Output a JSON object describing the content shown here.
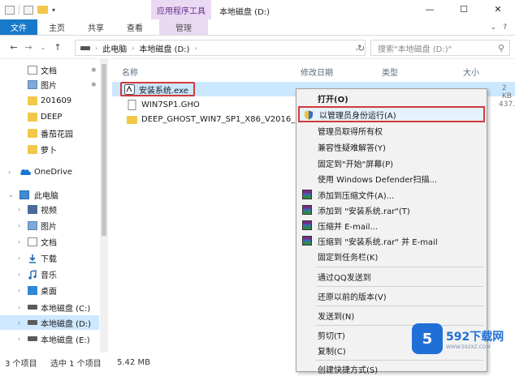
{
  "titlebar": {
    "context_tab_title": "应用程序工具",
    "window_title": "本地磁盘 (D:)",
    "controls": [
      "—",
      "☐",
      "✕"
    ]
  },
  "ribbon": {
    "tabs": [
      "文件",
      "主页",
      "共享",
      "查看",
      "管理"
    ],
    "right_icons": [
      "⌄",
      "?"
    ]
  },
  "address": {
    "back": "←",
    "forward": "→",
    "recent": "⌄",
    "up": "↑",
    "path": [
      "此电脑",
      "本地磁盘 (D:)"
    ],
    "search_placeholder": "搜索\"本地磁盘 (D:)\""
  },
  "sidebar": {
    "items": [
      {
        "label": "文档",
        "icon": "document-icon",
        "pinned": true
      },
      {
        "label": "图片",
        "icon": "pictures-icon",
        "pinned": true
      },
      {
        "label": "201609",
        "icon": "folder-icon"
      },
      {
        "label": "DEEP",
        "icon": "folder-icon"
      },
      {
        "label": "番茄花园",
        "icon": "folder-icon"
      },
      {
        "label": "萝卜",
        "icon": "folder-icon"
      },
      {
        "label": "OneDrive",
        "icon": "onedrive-icon"
      },
      {
        "label": "此电脑",
        "icon": "computer-icon"
      },
      {
        "label": "视频",
        "icon": "video-icon"
      },
      {
        "label": "图片",
        "icon": "pictures-icon"
      },
      {
        "label": "文档",
        "icon": "document-icon"
      },
      {
        "label": "下载",
        "icon": "download-icon"
      },
      {
        "label": "音乐",
        "icon": "music-icon"
      },
      {
        "label": "桌面",
        "icon": "desktop-icon"
      },
      {
        "label": "本地磁盘 (C:)",
        "icon": "drive-icon"
      },
      {
        "label": "本地磁盘 (D:)",
        "icon": "drive-icon",
        "selected": true
      },
      {
        "label": "本地磁盘 (E:)",
        "icon": "drive-icon"
      }
    ]
  },
  "columns": {
    "name": "名称",
    "modified": "修改日期",
    "type": "类型",
    "size": "大小"
  },
  "files": [
    {
      "name": "安装系统.exe",
      "icon": "exe-icon",
      "selected": true,
      "size_partial": "2 KB"
    },
    {
      "name": "WIN7SP1.GHO",
      "icon": "gho-file-icon",
      "size_partial": "437..."
    },
    {
      "name": "DEEP_GHOST_WIN7_SP1_X86_V2016_...",
      "icon": "folder-icon"
    }
  ],
  "status": {
    "count": "3 个项目",
    "selected": "选中 1 个项目",
    "size": "5.42 MB"
  },
  "context_menu": {
    "items": [
      {
        "label": "打开(O)",
        "bold": true
      },
      {
        "label": "以管理员身份运行(A)",
        "icon": "shield-icon",
        "highlighted": true
      },
      {
        "label": "管理员取得所有权"
      },
      {
        "label": "兼容性疑难解答(Y)"
      },
      {
        "label": "固定到\"开始\"屏幕(P)"
      },
      {
        "label": "使用 Windows Defender扫描..."
      },
      {
        "label": "添加到压缩文件(A)...",
        "icon": "rar-icon"
      },
      {
        "label": "添加到 \"安装系统.rar\"(T)",
        "icon": "rar-icon"
      },
      {
        "label": "压缩并 E-mail...",
        "icon": "rar-icon"
      },
      {
        "label": "压缩到 \"安装系统.rar\" 并 E-mail",
        "icon": "rar-icon"
      },
      {
        "label": "固定到任务栏(K)"
      },
      {
        "label": "通过QQ发送到"
      },
      {
        "label": "还原以前的版本(V)"
      },
      {
        "label": "发送到(N)"
      },
      {
        "label": "剪切(T)"
      },
      {
        "label": "复制(C)"
      },
      {
        "label": "创建快捷方式(S)"
      }
    ]
  },
  "watermark": {
    "logo": "5",
    "brand": "592下载网",
    "url": "WWW.592XZ.COM"
  },
  "colors": {
    "accent": "#1979ca",
    "context_tab": "#e9d9f2",
    "highlight_red": "#d23a3a",
    "selection": "#cce8ff"
  }
}
